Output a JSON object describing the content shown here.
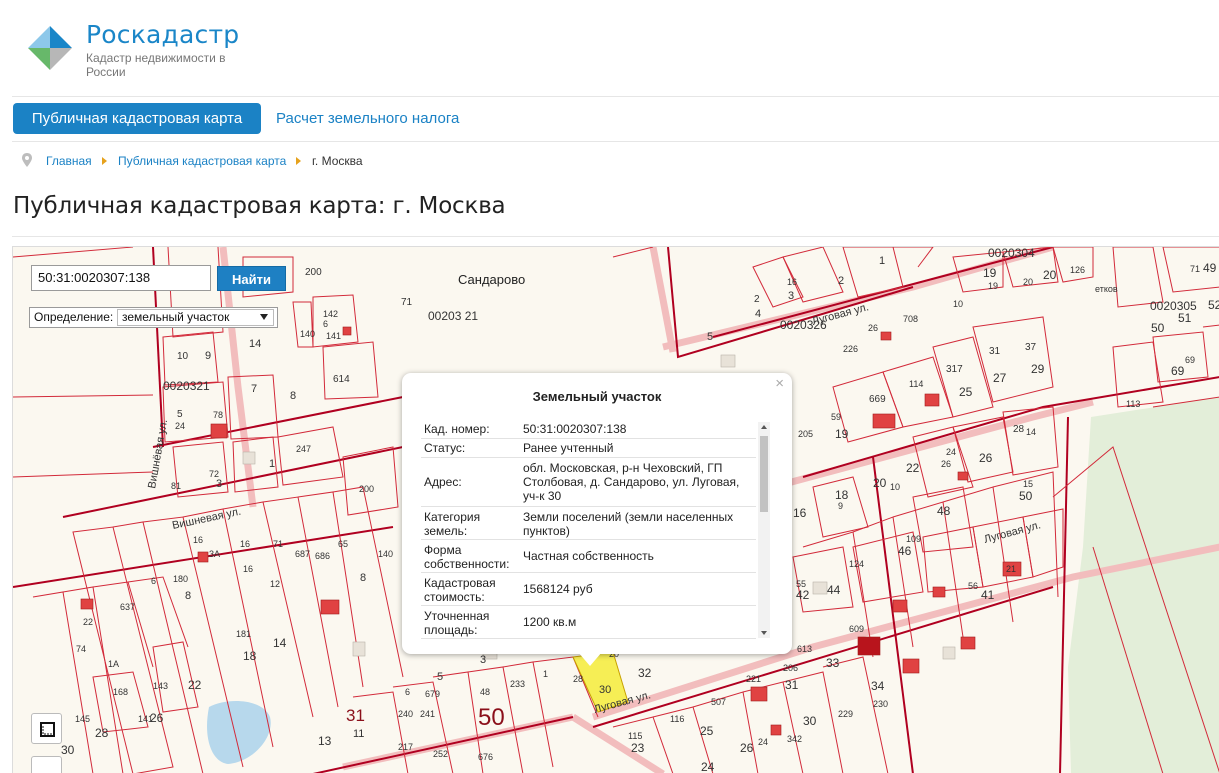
{
  "brand": {
    "title": "Роскадастр",
    "subtitle": "Кадастр недвижимости в России"
  },
  "nav": {
    "active_label": "Публичная кадастровая карта",
    "tax_label": "Расчет земельного налога"
  },
  "breadcrumb": {
    "home": "Главная",
    "map": "Публичная кадастровая карта",
    "current": "г. Москва"
  },
  "page_title": "Публичная кадастровая карта: г. Москва",
  "search": {
    "value": "50:31:0020307:138",
    "button_label": "Найти",
    "definition_label": "Определение:",
    "definition_value": "земельный участок"
  },
  "popup": {
    "title": "Земельный участок",
    "close": "×",
    "rows": [
      {
        "key": "Кад. номер:",
        "value": "50:31:0020307:138"
      },
      {
        "key": "Статус:",
        "value": "Ранее учтенный"
      },
      {
        "key": "Адрес:",
        "value": "обл. Московская, р-н Чеховский, ГП Столбовая, д. Сандарово, ул. Луговая, уч-к 30"
      },
      {
        "key": "Категория земель:",
        "value": "Земли поселений (земли населенных пунктов)"
      },
      {
        "key": "Форма собственности:",
        "value": "Частная собственность"
      },
      {
        "key": "Кадастровая стоимость:",
        "value": "1568124 руб"
      },
      {
        "key": "Уточненная площадь:",
        "value": "1200 кв.м"
      }
    ]
  },
  "map": {
    "village": "Сандарово",
    "quarters": [
      "0020321",
      "0020326",
      "00203 21",
      "0020305",
      "0020304"
    ],
    "streets": [
      "Вишнёвая ул.",
      "Вишневая ул.",
      "Луговая ул."
    ],
    "big_labels": [
      "50",
      "31"
    ],
    "selected_plot": "30",
    "colors": {
      "background": "#fbf8f0",
      "boundary": "#c8102e",
      "road": "#f4c0c0",
      "selected": "#f6ee55",
      "forest": "#e3eed9",
      "building": "#e04242",
      "water": "#b7d8ec"
    }
  }
}
